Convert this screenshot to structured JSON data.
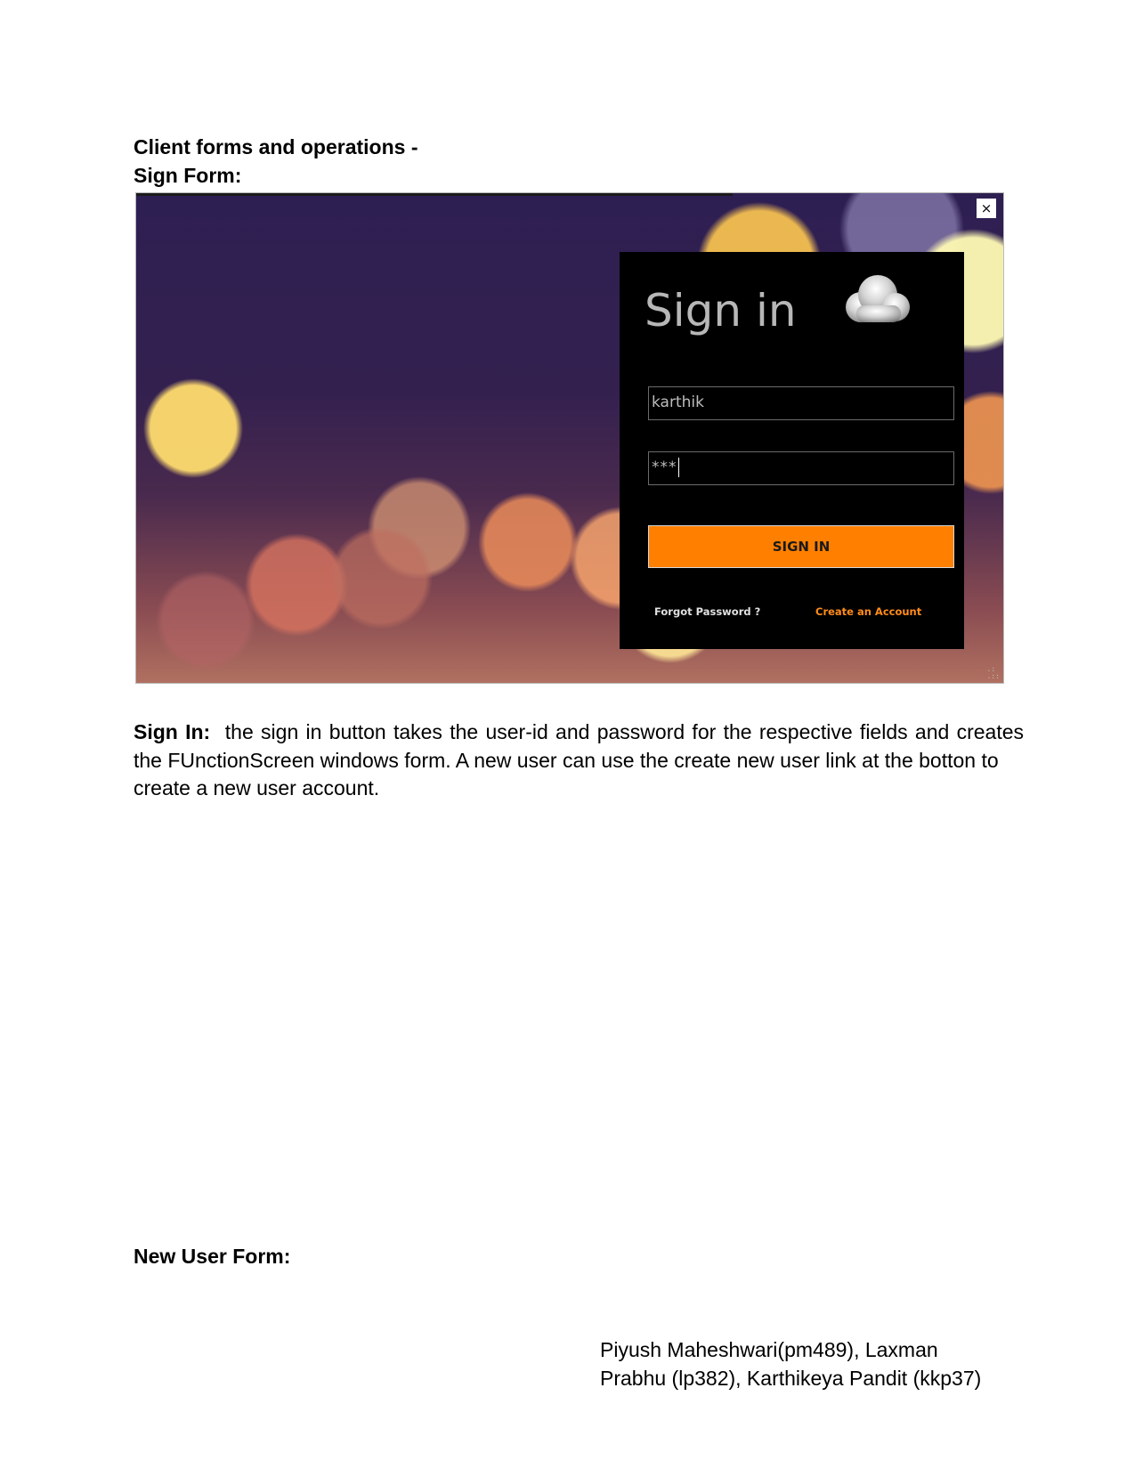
{
  "document": {
    "heading_client": "Client forms and operations -",
    "heading_sign_form": "Sign Form:",
    "paragraph": {
      "label": "Sign In:",
      "text_line1": "the sign in button takes the user-id and password for the respective fields and creates",
      "text_line2": "the FUnctionScreen windows form. A new user can use the create new user link at the botton to",
      "text_line3": "create a new user account."
    },
    "heading_new_user_form": "New User Form:",
    "authors_line1": "Piyush Maheshwari(pm489), Laxman",
    "authors_line2": "Prabhu (lp382), Karthikeya Pandit (kkp37)"
  },
  "sign_in_form": {
    "close_label": "×",
    "title": "Sign in",
    "icon": "cloud-icon",
    "username_value": "karthik",
    "password_value": "***",
    "sign_in_button_label": "SIGN IN",
    "forgot_password_label": "Forgot Password ?",
    "create_account_label": "Create an Account",
    "colors": {
      "panel_background": "#000000",
      "button": "#ff8000",
      "create_account_link": "#ff8c1a",
      "title_text": "#b7b7b7"
    }
  }
}
